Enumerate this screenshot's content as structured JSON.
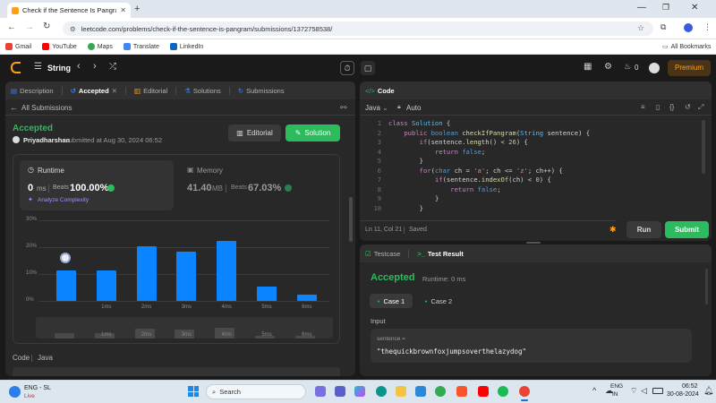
{
  "browser": {
    "tab_title": "Check if the Sentence Is Pangra…",
    "url": "leetcode.com/problems/check-if-the-sentence-is-pangram/submissions/1372758538/",
    "bookmarks": [
      "Gmail",
      "YouTube",
      "Maps",
      "Translate",
      "LinkedIn"
    ],
    "all_bookmarks": "All Bookmarks"
  },
  "header": {
    "problem_list": "String",
    "fire_count": "0",
    "premium": "Premium"
  },
  "left_tabs": {
    "description": "Description",
    "accepted": "Accepted",
    "editorial": "Editorial",
    "solutions": "Solutions",
    "submissions": "Submissions"
  },
  "submission": {
    "back_label": "All Submissions",
    "status": "Accepted",
    "user": "Priyadharshan",
    "submitted_text": "submitted at Aug 30, 2024 06:52",
    "editorial_btn": "Editorial",
    "solution_btn": "Solution"
  },
  "runtime": {
    "label": "Runtime",
    "value": "0",
    "unit": "ms",
    "beats_label": "Beats",
    "beats": "100.00%",
    "analyze": "Analyze Complexity"
  },
  "memory": {
    "label": "Memory",
    "value": "41.40",
    "unit": "MB",
    "beats_label": "Beats",
    "beats": "67.03%"
  },
  "chart_data": {
    "type": "bar",
    "categories": [
      "0ms",
      "1ms",
      "2ms",
      "3ms",
      "4ms",
      "5ms",
      "6ms"
    ],
    "values": [
      11.5,
      11.5,
      20.5,
      18.5,
      22.5,
      5.5,
      2.5
    ],
    "yticks": [
      "30%",
      "20%",
      "10%",
      "0%"
    ],
    "xticks": [
      "1ms",
      "2ms",
      "3ms",
      "4ms",
      "5ms",
      "6ms"
    ],
    "ylim": [
      0,
      30
    ]
  },
  "code_section": {
    "label": "Code",
    "language": "Java"
  },
  "editor": {
    "title": "Code",
    "language": "Java",
    "mode": "Auto",
    "lines": [
      "class Solution {",
      "    public boolean checkIfPangram(String sentence) {",
      "        if(sentence.length() < 26) {",
      "            return false;",
      "        }",
      "        for(char ch = 'a'; ch <= 'z'; ch++) {",
      "            if(sentence.indexOf(ch) < 0) {",
      "                return false;",
      "            }",
      "        }"
    ],
    "line_numbers": [
      "1",
      "2",
      "3",
      "4",
      "5",
      "6",
      "7",
      "8",
      "9",
      "10"
    ],
    "status": "Ln 11, Col 21",
    "saved": "Saved",
    "run": "Run",
    "submit": "Submit"
  },
  "results": {
    "testcase_tab": "Testcase",
    "result_tab": "Test Result",
    "status": "Accepted",
    "runtime": "Runtime: 0 ms",
    "case1": "Case 1",
    "case2": "Case 2",
    "input_label": "Input",
    "param": "sentence =",
    "value": "\"thequickbrownfoxjumpsoverthelazydog\""
  },
  "taskbar": {
    "weather_title": "ENG - SL",
    "weather_sub": "Live",
    "search": "Search",
    "lang": "ENG",
    "region": "IN",
    "time": "06:52",
    "date": "30-08-2024"
  },
  "colors": {
    "accent_green": "#2cbb5d",
    "bar_blue": "#0a84ff",
    "premium": "#ffa116"
  }
}
